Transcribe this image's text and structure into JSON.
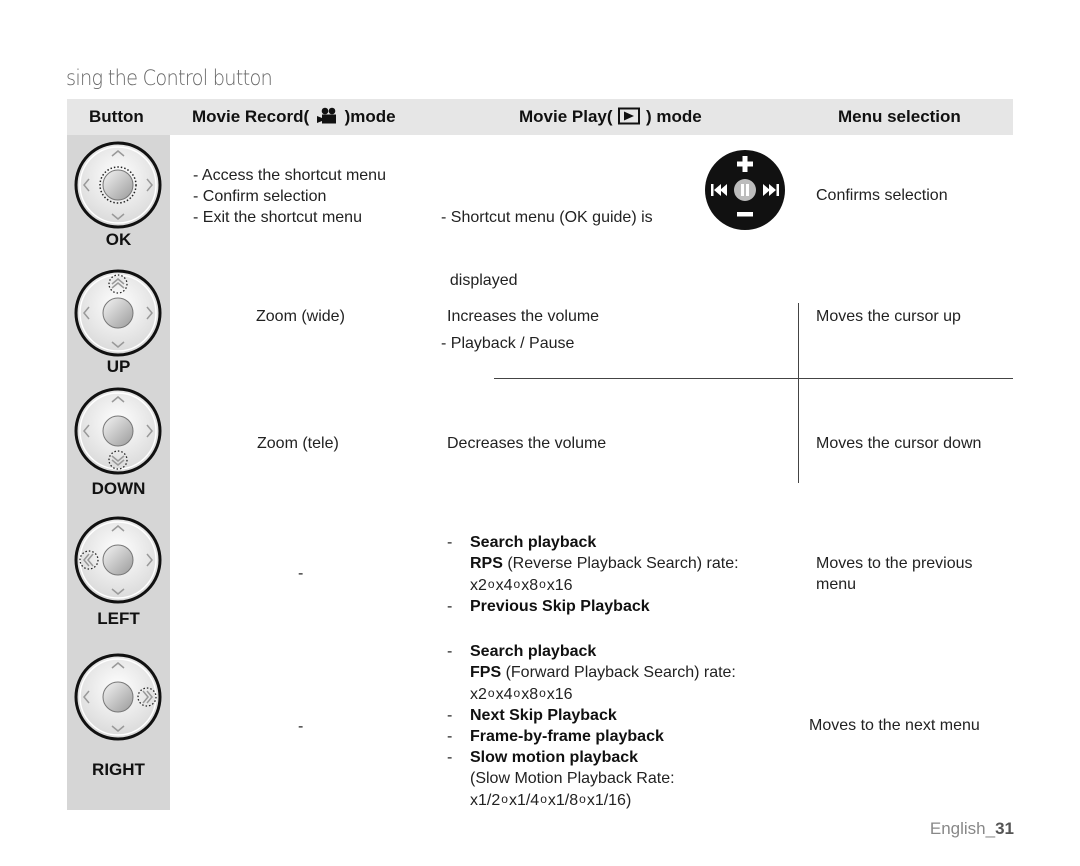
{
  "page": {
    "title": "sing the Control button",
    "footer": {
      "language": "English_",
      "page_number": "31"
    }
  },
  "table": {
    "headers": {
      "button": "Button",
      "record_prefix": "Movie Record(",
      "record_suffix": ")mode",
      "play_prefix": "Movie Play(",
      "play_suffix": ") mode",
      "menu": "Menu selection"
    },
    "header_icons": {
      "record": "movie-camera-icon",
      "play": "playback-mode-icon"
    },
    "rows": [
      {
        "button": "OK",
        "icon": "control-dial-ok-icon",
        "record": [
          "- Access the shortcut menu",
          "- Confirm selection",
          "- Exit the shortcut menu"
        ],
        "play": [
          "- Shortcut menu (OK guide) is",
          "  displayed",
          "- Playback / Pause"
        ],
        "play_icon": "ok-guide-icon",
        "menu": "Confirms selection"
      },
      {
        "button": "UP",
        "icon": "control-dial-up-icon",
        "record": "Zoom (wide)",
        "play": "Increases the volume",
        "menu": "Moves the cursor up"
      },
      {
        "button": "DOWN",
        "icon": "control-dial-down-icon",
        "record": "Zoom (tele)",
        "play": "Decreases the volume",
        "menu": "Moves the cursor down"
      },
      {
        "button": "LEFT",
        "icon": "control-dial-left-icon",
        "record": "-",
        "play": {
          "dash": "-",
          "item1_title": "Search playback",
          "item1_abbr": "RPS",
          "item1_desc": " (Reverse Playback Search) rate:",
          "rates": [
            "x2",
            "x4",
            "x8",
            "x16"
          ],
          "rate_separator": "o",
          "item2_title": "Previous Skip Playback"
        },
        "menu": [
          "Moves to the previous",
          "menu"
        ]
      },
      {
        "button": "RIGHT",
        "icon": "control-dial-right-icon",
        "record": "-",
        "play": {
          "dash": "-",
          "item1_title": "Search playback",
          "item1_abbr": "FPS",
          "item1_desc": " (Forward Playback Search) rate:",
          "rates": [
            "x2",
            "x4",
            "x8",
            "x16"
          ],
          "rate_separator": "o",
          "item2_title": "Next Skip Playback",
          "item3_title": "Frame-by-frame playback",
          "item4_title": "Slow motion playback",
          "item4_desc_line1": "(Slow Motion Playback Rate:",
          "slow_rates": [
            "x1/2",
            "x1/4",
            "x1/8",
            "x1/16)"
          ]
        },
        "menu": "Moves to the next menu"
      }
    ]
  },
  "colors": {
    "header_band": "#e6e6e6",
    "button_column": "#d6d6d6",
    "text": "#222222",
    "footer_text": "#888888"
  }
}
